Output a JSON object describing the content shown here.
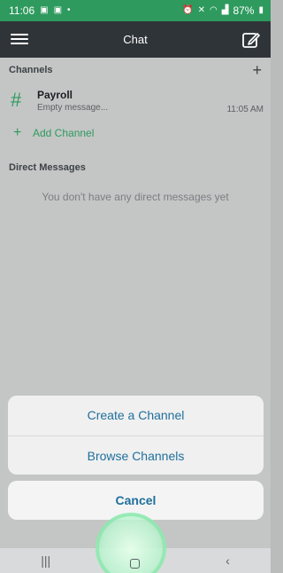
{
  "status_bar": {
    "time": "11:06",
    "battery": "87%"
  },
  "app_bar": {
    "title": "Chat"
  },
  "channels": {
    "header": "Channels",
    "items": [
      {
        "name": "Payroll",
        "preview": "Empty message...",
        "time": "11:05 AM"
      }
    ],
    "add_label": "Add Channel"
  },
  "direct_messages": {
    "header": "Direct Messages",
    "empty_text": "You don't have any direct messages yet"
  },
  "action_sheet": {
    "create_label": "Create a Channel",
    "browse_label": "Browse Channels",
    "cancel_label": "Cancel"
  },
  "colors": {
    "status_green": "#2e9a5e",
    "app_bar_dark": "#2f3439",
    "action_blue": "#1f6f9c"
  },
  "icons": {
    "menu": "hamburger-menu-icon",
    "compose": "compose-icon",
    "add": "plus-icon",
    "channel": "hash-icon",
    "nav_recents": "recents-icon",
    "nav_home": "home-icon",
    "nav_back": "back-icon"
  }
}
